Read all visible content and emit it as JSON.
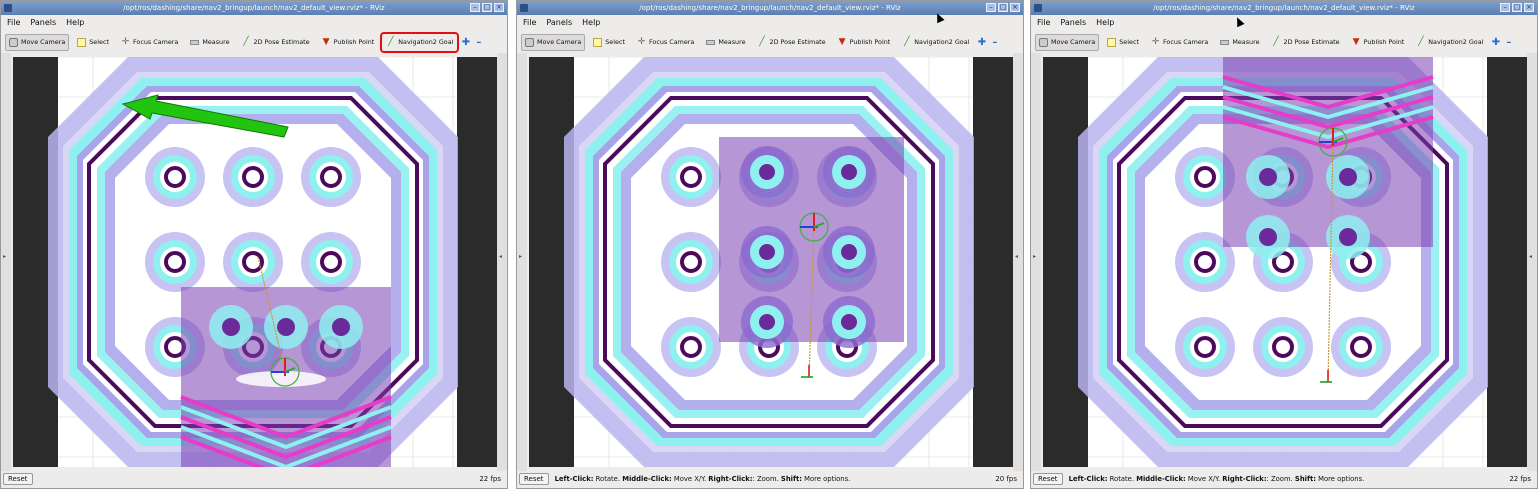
{
  "windows": [
    {
      "title": "/opt/ros/dashing/share/nav2_bringup/launch/nav2_default_view.rviz* - RViz",
      "menu": [
        "File",
        "Panels",
        "Help"
      ],
      "tools": [
        {
          "label": "Move Camera",
          "icon": "camera-icon"
        },
        {
          "label": "Select",
          "icon": "select-icon"
        },
        {
          "label": "Focus Camera",
          "icon": "focus-icon"
        },
        {
          "label": "Measure",
          "icon": "ruler-icon"
        },
        {
          "label": "2D Pose Estimate",
          "icon": "arrow-icon"
        },
        {
          "label": "Publish Point",
          "icon": "pin-icon"
        },
        {
          "label": "Navigation2 Goal",
          "icon": "arrow-icon"
        }
      ],
      "highlighted_tool": "Navigation2 Goal",
      "status": {
        "reset": "Reset",
        "hint": "",
        "fps": "22 fps"
      }
    },
    {
      "title": "/opt/ros/dashing/share/nav2_bringup/launch/nav2_default_view.rviz* - RViz",
      "menu": [
        "File",
        "Panels",
        "Help"
      ],
      "tools": [
        {
          "label": "Move Camera",
          "icon": "camera-icon"
        },
        {
          "label": "Select",
          "icon": "select-icon"
        },
        {
          "label": "Focus Camera",
          "icon": "focus-icon"
        },
        {
          "label": "Measure",
          "icon": "ruler-icon"
        },
        {
          "label": "2D Pose Estimate",
          "icon": "arrow-icon"
        },
        {
          "label": "Publish Point",
          "icon": "pin-icon"
        },
        {
          "label": "Navigation2 Goal",
          "icon": "arrow-icon"
        }
      ],
      "highlighted_tool": "",
      "status": {
        "reset": "Reset",
        "hint_parts": [
          [
            "Left-Click:",
            " Rotate. "
          ],
          [
            "Middle-Click:",
            " Move X/Y. "
          ],
          [
            "Right-Click:",
            ": Zoom. "
          ],
          [
            "Shift:",
            " More options."
          ]
        ],
        "fps": "20 fps"
      }
    },
    {
      "title": "/opt/ros/dashing/share/nav2_bringup/launch/nav2_default_view.rviz* - RViz",
      "menu": [
        "File",
        "Panels",
        "Help"
      ],
      "tools": [
        {
          "label": "Move Camera",
          "icon": "camera-icon"
        },
        {
          "label": "Select",
          "icon": "select-icon"
        },
        {
          "label": "Focus Camera",
          "icon": "focus-icon"
        },
        {
          "label": "Measure",
          "icon": "ruler-icon"
        },
        {
          "label": "2D Pose Estimate",
          "icon": "arrow-icon"
        },
        {
          "label": "Publish Point",
          "icon": "pin-icon"
        },
        {
          "label": "Navigation2 Goal",
          "icon": "arrow-icon"
        }
      ],
      "highlighted_tool": "",
      "status": {
        "reset": "Reset",
        "hint_parts": [
          [
            "Left-Click:",
            " Rotate. "
          ],
          [
            "Middle-Click:",
            " Move X/Y. "
          ],
          [
            "Right-Click:",
            ": Zoom. "
          ],
          [
            "Shift:",
            " More options."
          ]
        ],
        "fps": "22 fps"
      }
    }
  ],
  "colors": {
    "titlebar": "#5b7fb3",
    "highlight": "#e01010",
    "costmap_outer": "#b8b4ee",
    "costmap_mid": "#a9a4ea",
    "costmap_cyan": "#8ff0f0",
    "costmap_lethal": "#4c0a5c",
    "local_costmap": "#7a3fb0",
    "goal_arrow": "#22c40f"
  }
}
